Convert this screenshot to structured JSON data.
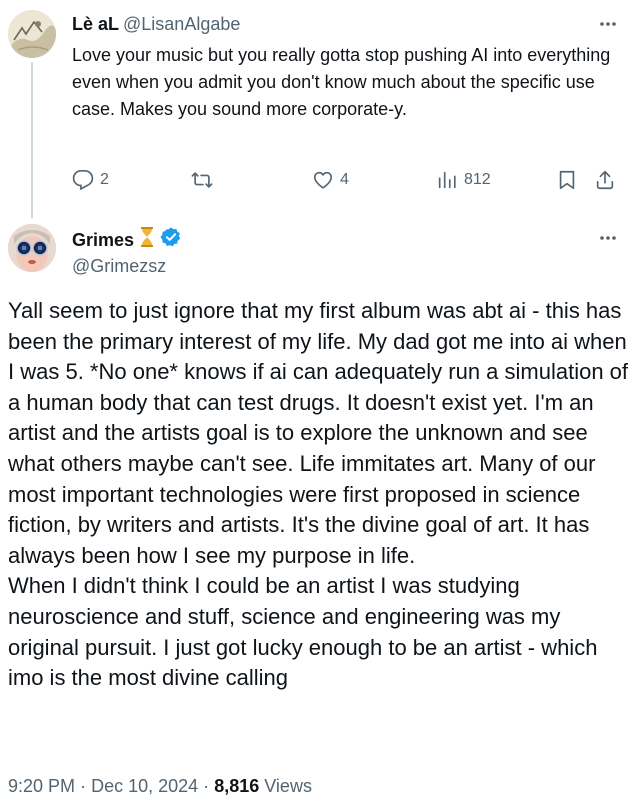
{
  "reply": {
    "name": "Lè aL",
    "handle": "@LisanAlgabe",
    "text": "Love your music but you really gotta stop pushing AI into everything even when you admit you don't know much about the specific use case. Makes you sound more corporate-y.",
    "replies": "2",
    "reposts": "",
    "likes": "4",
    "views": "812"
  },
  "main": {
    "name": "Grimes",
    "handle": "@Grimezsz",
    "paragraphs": [
      "Yall seem to just ignore that my first album was abt ai - this has been the primary interest of my life.  My dad got me into ai when I was 5.  *No one* knows if ai can adequately run a simulation of a human body that can test drugs.  It doesn't exist yet.  I'm an artist and the artists goal is to explore the unknown and see what others maybe can't see.  Life immitates art.  Many of our most important technologies were first proposed in science fiction, by writers and artists.  It's the divine goal of art.  It has always been how I see my purpose in life.",
      "When I didn't think I could be an artist I was studying neuroscience and stuff, science and engineering was my original pursuit.  I just got lucky enough to be an artist - which imo is the most divine calling"
    ],
    "time": "9:20 PM",
    "separator": "·",
    "date": "Dec 10, 2024",
    "views_count": "8,816",
    "views_label": "Views"
  },
  "colors": {
    "text": "#0f1419",
    "secondary": "#536471",
    "verified": "#1d9bf0",
    "hourglass": "#e0a020",
    "thread_line": "#cfd9de"
  },
  "icons": [
    "more-icon",
    "reply-icon",
    "repost-icon",
    "like-icon",
    "views-icon",
    "bookmark-icon",
    "share-icon",
    "hourglass-icon",
    "verified-icon"
  ]
}
